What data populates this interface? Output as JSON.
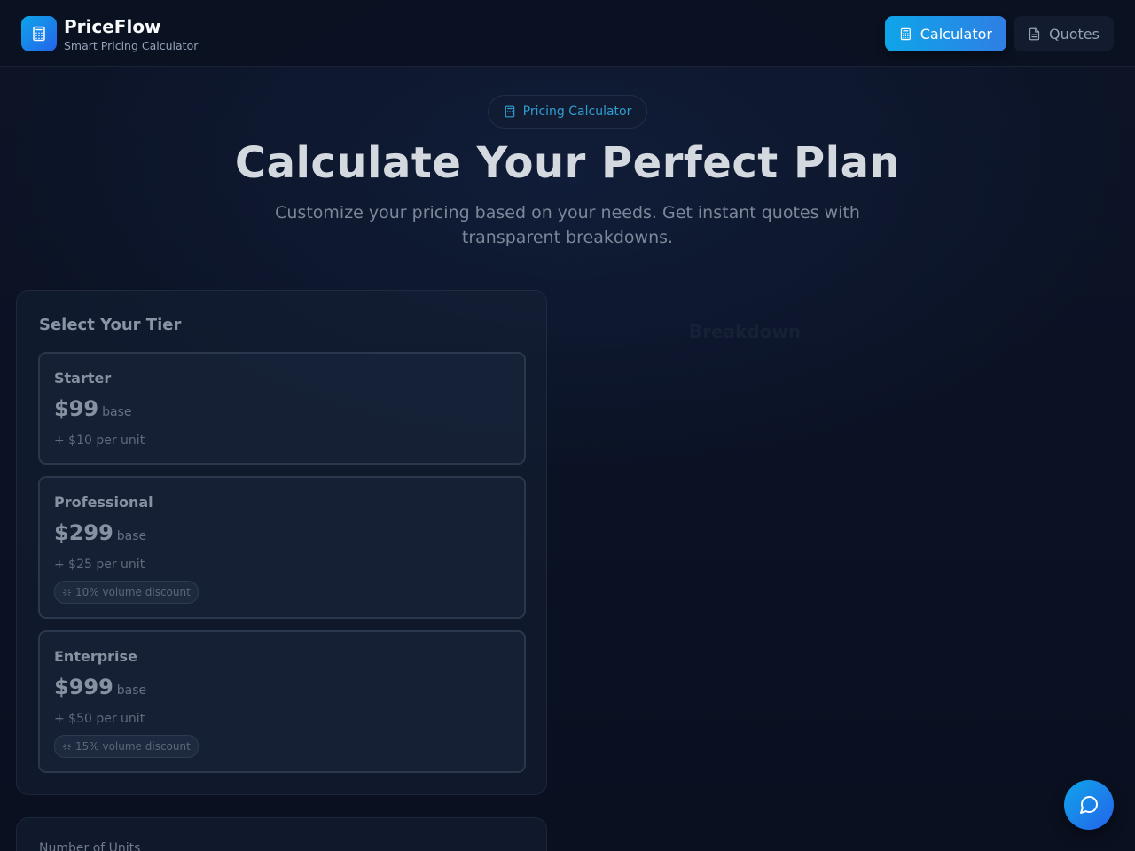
{
  "brand": {
    "name": "PriceFlow",
    "subtitle": "Smart Pricing Calculator",
    "icon": "calculator-icon"
  },
  "nav": {
    "calculator_label": "Calculator",
    "calculator_icon": "calculator-icon",
    "quotes_label": "Quotes",
    "quotes_icon": "document-icon",
    "active": "Calculator"
  },
  "hero": {
    "pill_label": "Pricing Calculator",
    "title": "Calculate Your Perfect Plan",
    "subtitle": "Customize your pricing based on your needs. Get instant quotes with transparent breakdowns."
  },
  "tier_panel": {
    "title": "Select Your Tier",
    "tiers": [
      {
        "name": "Starter",
        "price": "$99",
        "base_label": "base",
        "unit_price": "+ $10 per unit",
        "discount": ""
      },
      {
        "name": "Professional",
        "price": "$299",
        "base_label": "base",
        "unit_price": "+ $25 per unit",
        "discount": "10% volume discount"
      },
      {
        "name": "Enterprise",
        "price": "$999",
        "base_label": "base",
        "unit_price": "+ $50 per unit",
        "discount": "15% volume discount"
      }
    ]
  },
  "breakdown": {
    "faint_heading": "Breakdown"
  },
  "units_panel": {
    "label": "Number of Units"
  },
  "chat": {
    "icon": "chat-bubble-icon"
  },
  "colors": {
    "accent": "#0ea5e9",
    "accent_alt": "#2563eb",
    "background": "#0b1224"
  }
}
